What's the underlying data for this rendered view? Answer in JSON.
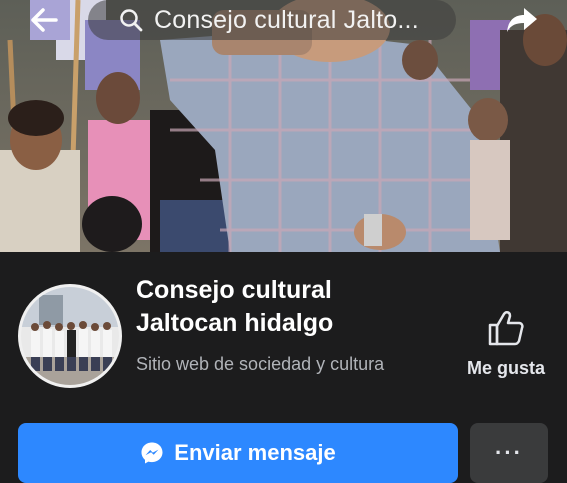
{
  "search": {
    "query": "Consejo cultural Jalto..."
  },
  "page": {
    "name_line1": "Consejo cultural",
    "name_line2": "Jaltocan hidalgo",
    "category": "Sitio web de sociedad y cultura"
  },
  "actions": {
    "like_label": "Me gusta",
    "message_label": "Enviar mensaje",
    "more_label": "···"
  },
  "colors": {
    "background": "#1c1c1d",
    "primary_button": "#2d88ff",
    "secondary_button": "#3a3b3c",
    "muted_text": "#b0b3b8"
  },
  "icons": [
    "back-arrow-icon",
    "search-icon",
    "share-icon",
    "thumbs-up-icon",
    "messenger-icon",
    "more-icon"
  ]
}
